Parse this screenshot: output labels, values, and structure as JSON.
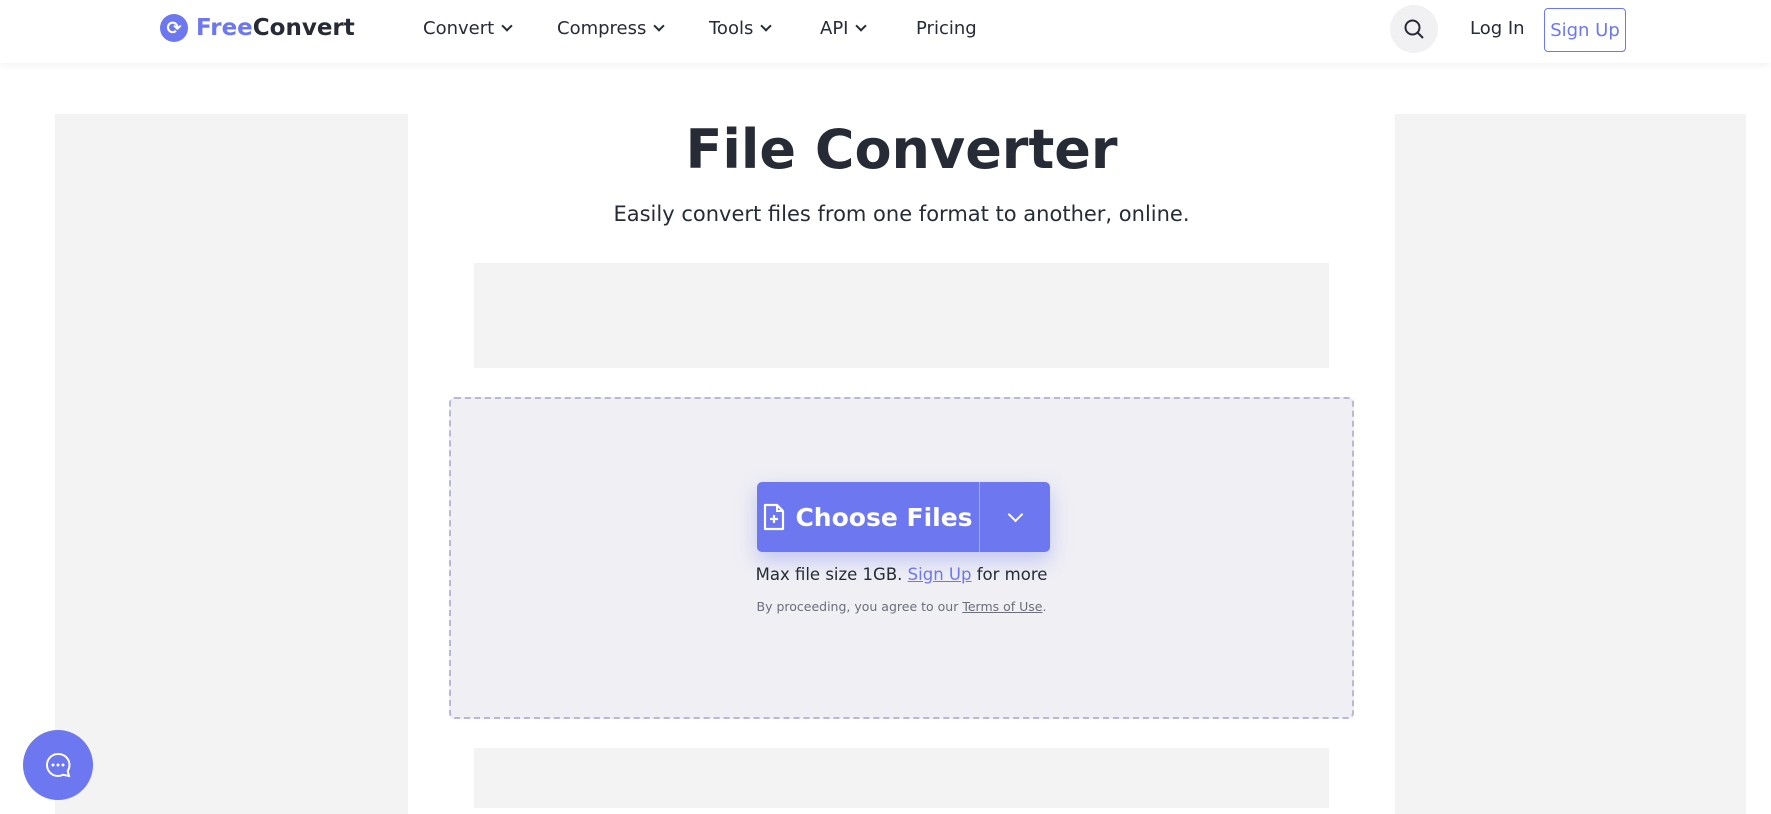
{
  "brand": {
    "part1": "Free",
    "part2": "Convert"
  },
  "nav": [
    {
      "label": "Convert"
    },
    {
      "label": "Compress"
    },
    {
      "label": "Tools"
    },
    {
      "label": "API"
    },
    {
      "label": "Pricing"
    }
  ],
  "auth": {
    "login": "Log In",
    "signup": "Sign Up"
  },
  "hero": {
    "title": "File Converter",
    "subtitle": "Easily convert files from one format to another, online."
  },
  "upload": {
    "button": "Choose Files",
    "max_prefix": "Max file size 1GB.",
    "max_link": "Sign Up",
    "max_suffix": "for more",
    "terms_prefix": "By proceeding, you agree to our",
    "terms_link": "Terms of Use",
    "terms_suffix": "."
  },
  "colors": {
    "accent": "#6c77f0"
  }
}
